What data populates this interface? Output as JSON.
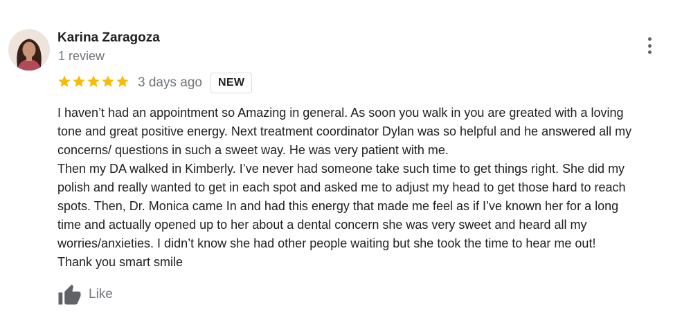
{
  "reviewer": {
    "name": "Karina Zaragoza",
    "review_count": "1 review"
  },
  "review": {
    "rating": 5,
    "max_rating": 5,
    "date": "3 days ago",
    "badge": "NEW",
    "lines": [
      "I haven’t had an appointment so Amazing in general. As soon you walk in you are greated with a loving",
      "tone and great positive energy. Next treatment coordinator Dylan was so helpful and he answered all my",
      "concerns/ questions in such a sweet way. He was very patient with me.",
      "Then my DA walked in Kimberly. I’ve never had someone take such time to get things right. She did my",
      "polish and really wanted to get in each spot and asked me to adjust my head to get those hard to reach",
      "spots. Then, Dr. Monica came In and had this energy that made me feel as if I’ve known her for a long",
      "time and actually opened up to her about a dental concern she was very sweet and heard all my",
      "worries/anxieties.  I didn’t know she had other people waiting but she took the time to hear me out!",
      "Thank you smart smile"
    ]
  },
  "actions": {
    "like_label": "Like",
    "like_icon": "thumbs-up-icon",
    "more_icon": "more-vert-icon"
  },
  "colors": {
    "star": "#f9bc05",
    "secondary_text": "#70757a",
    "primary_text": "#202124",
    "icon": "#5f6368"
  }
}
